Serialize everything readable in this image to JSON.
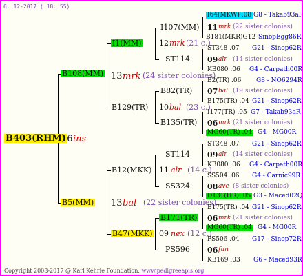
{
  "header": {
    "date": "6. 12-2017 ( 18: 55)"
  },
  "root": {
    "id": "B403(RHM)",
    "gen": "16",
    "ins": "ins"
  },
  "upper": {
    "id": "B108(MM)",
    "gen": "13",
    "mrk": "mrk",
    "note": "(24 sister colonies)",
    "a": {
      "id": "I1(MM)",
      "gen": "12",
      "mrk": "mrk",
      "note": "(21 c.)",
      "a1": {
        "id": "I107(MM)",
        "line1": {
          "code": "I64(MKW) .08",
          "right": "G8 - Takab93aR"
        },
        "line2": {
          "gen": "11",
          "mrk": "mrk",
          "note": "(22 sister colonies)"
        },
        "line3": {
          "code": "B181(MKR)G12",
          "right": "-SinopEgg86R"
        }
      },
      "a2": {
        "id": "ST114",
        "line1": {
          "code": "ST348 .07",
          "right": "G21 - Sinop62R"
        },
        "line2": {
          "gen": "09",
          "mrk": "alr",
          "note": "(14 sister colonies)"
        },
        "line3": {
          "code": "KB080 .06",
          "right": "G4 - Carpath00R"
        }
      }
    },
    "b": {
      "id": "B129(TR)",
      "gen": "10",
      "mrk": "bal",
      "note": "(23 c.)",
      "b1": {
        "id": "B82(TR)",
        "line1": {
          "code": "B2(TR) .06",
          "right": "G8 - NO6294R"
        },
        "line2": {
          "gen": "07",
          "mrk": "bal",
          "note": "(19 sister colonies)"
        },
        "line3": {
          "code": "B175(TR) .04",
          "right": "G21 - Sinop62R"
        }
      },
      "b2": {
        "id": "B135(TR)",
        "line1": {
          "code": "I177(TR) .05",
          "right": "G7 - Takab93aR"
        },
        "line2": {
          "gen": "06",
          "mrk": "mrk",
          "note": "(21 sister colonies)"
        },
        "line3": {
          "code": "MG60(TR) .04",
          "right": "G4 - MG00R"
        }
      }
    }
  },
  "lower": {
    "id": "B5(MM)",
    "gen": "13",
    "mrk": "bal",
    "note": "(22 sister colonies)",
    "a": {
      "id": "B12(MKK)",
      "gen": "11",
      "mrk": "alr",
      "note": "(14 c.)",
      "a1": {
        "id": "ST114",
        "line1": {
          "code": "ST348 .07",
          "right": "G21 - Sinop62R"
        },
        "line2": {
          "gen": "09",
          "mrk": "alr",
          "note": "(14 sister colonies)"
        },
        "line3": {
          "code": "KB080 .06",
          "right": "G4 - Carpath00R"
        }
      },
      "a2": {
        "id": "SS324",
        "line1": {
          "code": "SS504 .06",
          "right": "G4 - Carnic99R"
        },
        "line2": {
          "gen": "08",
          "mrk": "ave",
          "note": "(8 sister colonies)"
        },
        "line3": {
          "code": "D131(HR) .05",
          "right": "G3 - Maced02Q"
        }
      }
    },
    "b": {
      "id": "B47(MKK)",
      "gen": "09",
      "mrk": "nex",
      "note": "(12 c.)",
      "b1": {
        "id": "B171(TR)",
        "line1": {
          "code": "B175(TR) .04",
          "right": "G21 - Sinop62R"
        },
        "line2": {
          "gen": "06",
          "mrk": "mrk",
          "note": "(21 sister colonies)"
        },
        "line3": {
          "code": "MG60(TR) .04",
          "right": "G4 - MG00R"
        }
      },
      "b2": {
        "id": "PS596",
        "line1": {
          "code": "PS506 .04",
          "right": "G17 - Sinop72R"
        },
        "line2": {
          "gen": "06",
          "mrk": "fun",
          "note": ""
        },
        "line3": {
          "code": "KB169 .03",
          "right": "G6 - Maced93R"
        }
      }
    }
  },
  "footer": {
    "copyright": "Copyright 2008-2017 @ Karl Kehrle Foundation.",
    "site": "www.pedigreeapis.org"
  }
}
